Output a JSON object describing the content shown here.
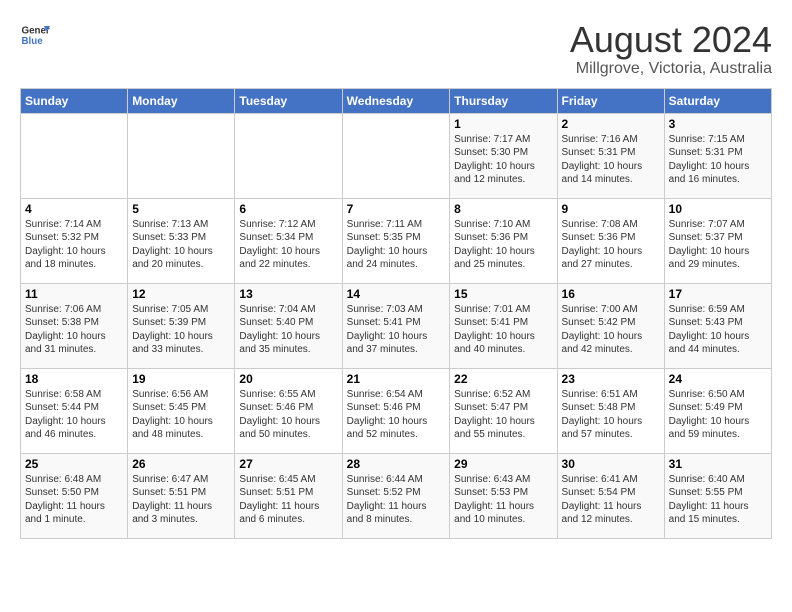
{
  "logo": {
    "text_general": "General",
    "text_blue": "Blue"
  },
  "title": {
    "month_year": "August 2024",
    "location": "Millgrove, Victoria, Australia"
  },
  "days_of_week": [
    "Sunday",
    "Monday",
    "Tuesday",
    "Wednesday",
    "Thursday",
    "Friday",
    "Saturday"
  ],
  "weeks": [
    [
      {
        "day": "",
        "info": ""
      },
      {
        "day": "",
        "info": ""
      },
      {
        "day": "",
        "info": ""
      },
      {
        "day": "",
        "info": ""
      },
      {
        "day": "1",
        "info": "Sunrise: 7:17 AM\nSunset: 5:30 PM\nDaylight: 10 hours\nand 12 minutes."
      },
      {
        "day": "2",
        "info": "Sunrise: 7:16 AM\nSunset: 5:31 PM\nDaylight: 10 hours\nand 14 minutes."
      },
      {
        "day": "3",
        "info": "Sunrise: 7:15 AM\nSunset: 5:31 PM\nDaylight: 10 hours\nand 16 minutes."
      }
    ],
    [
      {
        "day": "4",
        "info": "Sunrise: 7:14 AM\nSunset: 5:32 PM\nDaylight: 10 hours\nand 18 minutes."
      },
      {
        "day": "5",
        "info": "Sunrise: 7:13 AM\nSunset: 5:33 PM\nDaylight: 10 hours\nand 20 minutes."
      },
      {
        "day": "6",
        "info": "Sunrise: 7:12 AM\nSunset: 5:34 PM\nDaylight: 10 hours\nand 22 minutes."
      },
      {
        "day": "7",
        "info": "Sunrise: 7:11 AM\nSunset: 5:35 PM\nDaylight: 10 hours\nand 24 minutes."
      },
      {
        "day": "8",
        "info": "Sunrise: 7:10 AM\nSunset: 5:36 PM\nDaylight: 10 hours\nand 25 minutes."
      },
      {
        "day": "9",
        "info": "Sunrise: 7:08 AM\nSunset: 5:36 PM\nDaylight: 10 hours\nand 27 minutes."
      },
      {
        "day": "10",
        "info": "Sunrise: 7:07 AM\nSunset: 5:37 PM\nDaylight: 10 hours\nand 29 minutes."
      }
    ],
    [
      {
        "day": "11",
        "info": "Sunrise: 7:06 AM\nSunset: 5:38 PM\nDaylight: 10 hours\nand 31 minutes."
      },
      {
        "day": "12",
        "info": "Sunrise: 7:05 AM\nSunset: 5:39 PM\nDaylight: 10 hours\nand 33 minutes."
      },
      {
        "day": "13",
        "info": "Sunrise: 7:04 AM\nSunset: 5:40 PM\nDaylight: 10 hours\nand 35 minutes."
      },
      {
        "day": "14",
        "info": "Sunrise: 7:03 AM\nSunset: 5:41 PM\nDaylight: 10 hours\nand 37 minutes."
      },
      {
        "day": "15",
        "info": "Sunrise: 7:01 AM\nSunset: 5:41 PM\nDaylight: 10 hours\nand 40 minutes."
      },
      {
        "day": "16",
        "info": "Sunrise: 7:00 AM\nSunset: 5:42 PM\nDaylight: 10 hours\nand 42 minutes."
      },
      {
        "day": "17",
        "info": "Sunrise: 6:59 AM\nSunset: 5:43 PM\nDaylight: 10 hours\nand 44 minutes."
      }
    ],
    [
      {
        "day": "18",
        "info": "Sunrise: 6:58 AM\nSunset: 5:44 PM\nDaylight: 10 hours\nand 46 minutes."
      },
      {
        "day": "19",
        "info": "Sunrise: 6:56 AM\nSunset: 5:45 PM\nDaylight: 10 hours\nand 48 minutes."
      },
      {
        "day": "20",
        "info": "Sunrise: 6:55 AM\nSunset: 5:46 PM\nDaylight: 10 hours\nand 50 minutes."
      },
      {
        "day": "21",
        "info": "Sunrise: 6:54 AM\nSunset: 5:46 PM\nDaylight: 10 hours\nand 52 minutes."
      },
      {
        "day": "22",
        "info": "Sunrise: 6:52 AM\nSunset: 5:47 PM\nDaylight: 10 hours\nand 55 minutes."
      },
      {
        "day": "23",
        "info": "Sunrise: 6:51 AM\nSunset: 5:48 PM\nDaylight: 10 hours\nand 57 minutes."
      },
      {
        "day": "24",
        "info": "Sunrise: 6:50 AM\nSunset: 5:49 PM\nDaylight: 10 hours\nand 59 minutes."
      }
    ],
    [
      {
        "day": "25",
        "info": "Sunrise: 6:48 AM\nSunset: 5:50 PM\nDaylight: 11 hours\nand 1 minute."
      },
      {
        "day": "26",
        "info": "Sunrise: 6:47 AM\nSunset: 5:51 PM\nDaylight: 11 hours\nand 3 minutes."
      },
      {
        "day": "27",
        "info": "Sunrise: 6:45 AM\nSunset: 5:51 PM\nDaylight: 11 hours\nand 6 minutes."
      },
      {
        "day": "28",
        "info": "Sunrise: 6:44 AM\nSunset: 5:52 PM\nDaylight: 11 hours\nand 8 minutes."
      },
      {
        "day": "29",
        "info": "Sunrise: 6:43 AM\nSunset: 5:53 PM\nDaylight: 11 hours\nand 10 minutes."
      },
      {
        "day": "30",
        "info": "Sunrise: 6:41 AM\nSunset: 5:54 PM\nDaylight: 11 hours\nand 12 minutes."
      },
      {
        "day": "31",
        "info": "Sunrise: 6:40 AM\nSunset: 5:55 PM\nDaylight: 11 hours\nand 15 minutes."
      }
    ]
  ]
}
